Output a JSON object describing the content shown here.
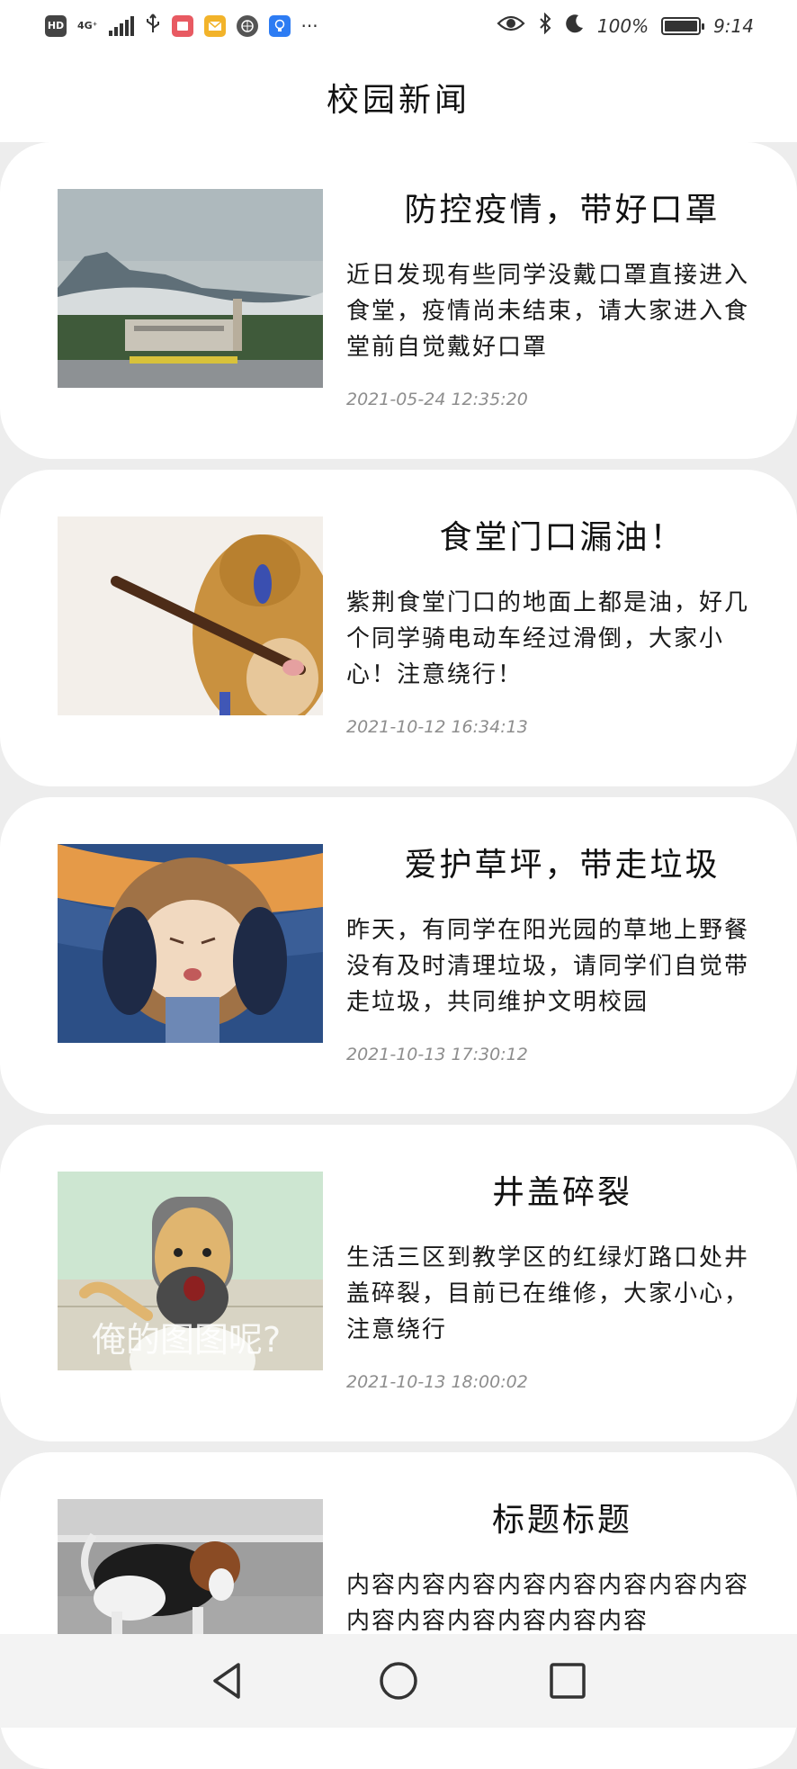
{
  "status_bar": {
    "network_small": "4G⁺",
    "more": "···",
    "battery_percent": "100%",
    "time": "9:14",
    "icons": [
      "hd-icon",
      "signal-icon",
      "usb-icon",
      "book-app-icon",
      "mail-app-icon",
      "sphere-app-icon",
      "bulb-app-icon",
      "eye-icon",
      "bluetooth-icon",
      "moon-icon",
      "battery-icon"
    ]
  },
  "header": {
    "title": "校园新闻"
  },
  "news": [
    {
      "title": "防控疫情，带好口罩",
      "body": "近日发现有些同学没戴口罩直接进入食堂，疫情尚未结束，请大家进入食堂前自觉戴好口罩",
      "time": "2021-05-24 12:35:20"
    },
    {
      "title": "食堂门口漏油！",
      "body": "紫荆食堂门口的地面上都是油，好几个同学骑电动车经过滑倒，大家小心！注意绕行！",
      "time": "2021-10-12 16:34:13"
    },
    {
      "title": "爱护草坪，带走垃圾",
      "body": "昨天，有同学在阳光园的草地上野餐没有及时清理垃圾，请同学们自觉带走垃圾，共同维护文明校园",
      "time": "2021-10-13 17:30:12"
    },
    {
      "title": "井盖碎裂",
      "body": "生活三区到教学区的红绿灯路口处井盖碎裂，目前已在维修，大家小心，注意绕行",
      "time": "2021-10-13 18:00:02",
      "image_caption": "俺的图图呢?"
    },
    {
      "title": "标题标题",
      "body": "内容内容内容内容内容内容内容内容内容内容内容内容内容内容"
    }
  ],
  "nav_bar": {
    "icons": [
      "back-icon",
      "home-icon",
      "recents-icon"
    ]
  }
}
